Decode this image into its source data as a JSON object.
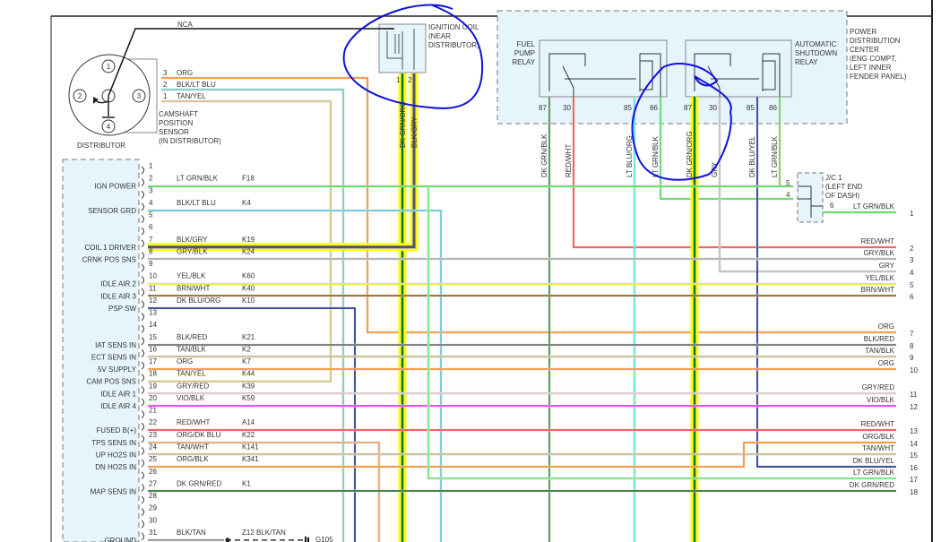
{
  "distributor": {
    "label": "DISTRIBUTOR",
    "terminals": [
      "1",
      "2",
      "3",
      "4"
    ],
    "nca": "NCA"
  },
  "camshaft_sensor": {
    "label": [
      "CAMSHAFT",
      "POSITION",
      "SENSOR",
      "(IN DISTRIBUTOR)"
    ],
    "pins": [
      {
        "pin": "3",
        "wire": "ORG",
        "color": "#ff8c1a"
      },
      {
        "pin": "2",
        "wire": "BLK/LT BLU",
        "color": "#6cc"
      },
      {
        "pin": "1",
        "wire": "TAN/YEL",
        "color": "#d8c27a"
      }
    ]
  },
  "ignition_coil": {
    "label": [
      "IGNITION COIL",
      "(NEAR",
      "DISTRIBUTOR)"
    ],
    "pins": [
      {
        "pin": "1",
        "wire": "DK GRN/ORG"
      },
      {
        "pin": "2",
        "wire": "BLK/GRY"
      }
    ]
  },
  "pdc": {
    "label": [
      "POWER",
      "DISTRIBUTION",
      "CENTER",
      "(ENG COMPT,",
      "LEFT INNER",
      "FENDER PANEL)"
    ],
    "fuel_pump_relay": {
      "label": [
        "FUEL",
        "PUMP",
        "RELAY"
      ],
      "terminals": [
        {
          "num": "87",
          "wire": "DK GRN/BLK",
          "color": "#2e8b2e"
        },
        {
          "num": "30",
          "wire": "RED/WHT",
          "color": "#ff3b3b"
        },
        {
          "num": "85",
          "wire": "LT BLU/ORG",
          "color": "#4de8e8"
        },
        {
          "num": "86",
          "wire": "LT GRN/BLK",
          "color": "#4ddd4d"
        }
      ]
    },
    "asd_relay": {
      "label": [
        "AUTOMATIC",
        "SHUTDOWN",
        "RELAY"
      ],
      "terminals": [
        {
          "num": "87",
          "wire": "DK GRN/ORG",
          "color": "#0a7a0a"
        },
        {
          "num": "30",
          "wire": "GRY",
          "color": "#bbbbbb"
        },
        {
          "num": "85",
          "wire": "DK BLU/YEL",
          "color": "#0a2a8a"
        },
        {
          "num": "86",
          "wire": "LT GRN/BLK",
          "color": "#4ddd4d"
        }
      ]
    }
  },
  "junction": {
    "label": [
      "J/C 1",
      "(LEFT END",
      "OF DASH)"
    ],
    "pins": [
      "5",
      "4",
      "6"
    ],
    "out_wire": "LT GRN/BLK"
  },
  "pcm_pins": [
    {
      "pin": "1",
      "function": "",
      "wire": "",
      "circuit": "",
      "color": ""
    },
    {
      "pin": "2",
      "function": "IGN POWER",
      "wire": "LT GRN/BLK",
      "circuit": "F18",
      "color": "#44dd44"
    },
    {
      "pin": "3",
      "function": "",
      "wire": "",
      "circuit": "",
      "color": ""
    },
    {
      "pin": "4",
      "function": "SENSOR GRD",
      "wire": "BLK/LT BLU",
      "circuit": "K4",
      "color": "#55ccdd"
    },
    {
      "pin": "5",
      "function": "",
      "wire": "",
      "circuit": "",
      "color": ""
    },
    {
      "pin": "6",
      "function": "",
      "wire": "",
      "circuit": "",
      "color": ""
    },
    {
      "pin": "7",
      "function": "COIL 1 DRIVER",
      "wire": "BLK/GRY",
      "circuit": "K19",
      "color": "#555555"
    },
    {
      "pin": "8",
      "function": "CRNK POS SNS",
      "wire": "GRY/BLK",
      "circuit": "K24",
      "color": "#aaaaaa"
    },
    {
      "pin": "9",
      "function": "",
      "wire": "",
      "circuit": "",
      "color": ""
    },
    {
      "pin": "10",
      "function": "IDLE AIR 2",
      "wire": "YEL/BLK",
      "circuit": "K60",
      "color": "#eeee22"
    },
    {
      "pin": "11",
      "function": "IDLE AIR 3",
      "wire": "BRN/WHT",
      "circuit": "K40",
      "color": "#8b5a00"
    },
    {
      "pin": "12",
      "function": "PSP SW",
      "wire": "DK BLU/ORG",
      "circuit": "K10",
      "color": "#0a2a8a"
    },
    {
      "pin": "13",
      "function": "",
      "wire": "",
      "circuit": "",
      "color": ""
    },
    {
      "pin": "14",
      "function": "",
      "wire": "",
      "circuit": "",
      "color": ""
    },
    {
      "pin": "15",
      "function": "IAT SENS IN",
      "wire": "BLK/RED",
      "circuit": "K21",
      "color": "#666666"
    },
    {
      "pin": "16",
      "function": "ECT SENS IN",
      "wire": "TAN/BLK",
      "circuit": "K2",
      "color": "#c8b88a"
    },
    {
      "pin": "17",
      "function": "5V SUPPLY",
      "wire": "ORG",
      "circuit": "K7",
      "color": "#ff8c1a"
    },
    {
      "pin": "18",
      "function": "CAM POS SNS",
      "wire": "TAN/YEL",
      "circuit": "K44",
      "color": "#d8c27a"
    },
    {
      "pin": "19",
      "function": "IDLE AIR 1",
      "wire": "GRY/RED",
      "circuit": "K39",
      "color": "#e0c8c8"
    },
    {
      "pin": "20",
      "function": "IDLE AIR 4",
      "wire": "VIO/BLK",
      "circuit": "K59",
      "color": "#ff22ff"
    },
    {
      "pin": "21",
      "function": "",
      "wire": "",
      "circuit": "",
      "color": ""
    },
    {
      "pin": "22",
      "function": "FUSED B(+)",
      "wire": "RED/WHT",
      "circuit": "A14",
      "color": "#ff3b3b"
    },
    {
      "pin": "23",
      "function": "TPS SENS IN",
      "wire": "ORG/DK BLU",
      "circuit": "K22",
      "color": "#f0a060"
    },
    {
      "pin": "24",
      "function": "UP HO2S IN",
      "wire": "TAN/WHT",
      "circuit": "K141",
      "color": "#c8b88a"
    },
    {
      "pin": "25",
      "function": "DN HO2S IN",
      "wire": "ORG/BLK",
      "circuit": "K341",
      "color": "#ff8c1a"
    },
    {
      "pin": "26",
      "function": "",
      "wire": "",
      "circuit": "",
      "color": ""
    },
    {
      "pin": "27",
      "function": "MAP SENS IN",
      "wire": "DK GRN/RED",
      "circuit": "K1",
      "color": "#1a6a1a"
    },
    {
      "pin": "28",
      "function": "",
      "wire": "",
      "circuit": "",
      "color": ""
    },
    {
      "pin": "29",
      "function": "",
      "wire": "",
      "circuit": "",
      "color": ""
    },
    {
      "pin": "30",
      "function": "",
      "wire": "",
      "circuit": "",
      "color": ""
    },
    {
      "pin": "31",
      "function": "GROUND",
      "wire": "BLK/TAN",
      "circuit": "Z12",
      "color": "#888888"
    }
  ],
  "ground": {
    "wire": "BLK/TAN",
    "label": "G105"
  },
  "right_connector": [
    {
      "num": "1",
      "wire": "LT GRN/BLK",
      "color": "#44dd44"
    },
    {
      "num": "2",
      "wire": "RED/WHT",
      "color": "#ff3b3b"
    },
    {
      "num": "3",
      "wire": "GRY/BLK",
      "color": "#aaaaaa"
    },
    {
      "num": "4",
      "wire": "GRY",
      "color": "#bbbbbb"
    },
    {
      "num": "5",
      "wire": "YEL/BLK",
      "color": "#eeee22"
    },
    {
      "num": "6",
      "wire": "BRN/WHT",
      "color": "#8b5a00"
    },
    {
      "num": "7",
      "wire": "ORG",
      "color": "#ff8c1a"
    },
    {
      "num": "8",
      "wire": "BLK/RED",
      "color": "#666666"
    },
    {
      "num": "9",
      "wire": "TAN/BLK",
      "color": "#c8b88a"
    },
    {
      "num": "10",
      "wire": "ORG",
      "color": "#ff8c1a"
    },
    {
      "num": "11",
      "wire": "GRY/RED",
      "color": "#e0c8c8"
    },
    {
      "num": "12",
      "wire": "VIO/BLK",
      "color": "#ff22ff"
    },
    {
      "num": "13",
      "wire": "RED/WHT",
      "color": "#ff3b3b"
    },
    {
      "num": "14",
      "wire": "ORG/BLK",
      "color": "#ff8c1a"
    },
    {
      "num": "15",
      "wire": "TAN/WHT",
      "color": "#c8b88a"
    },
    {
      "num": "16",
      "wire": "DK BLU/YEL",
      "color": "#0a2a8a"
    },
    {
      "num": "17",
      "wire": "LT GRN/BLK",
      "color": "#44dd44"
    },
    {
      "num": "18",
      "wire": "DK GRN/RED",
      "color": "#1a6a1a"
    }
  ],
  "colors": {
    "highlight": "#ffff00",
    "annotation": "#1010e0",
    "box_fill": "#e6f4fc",
    "dashed": "#777777"
  }
}
